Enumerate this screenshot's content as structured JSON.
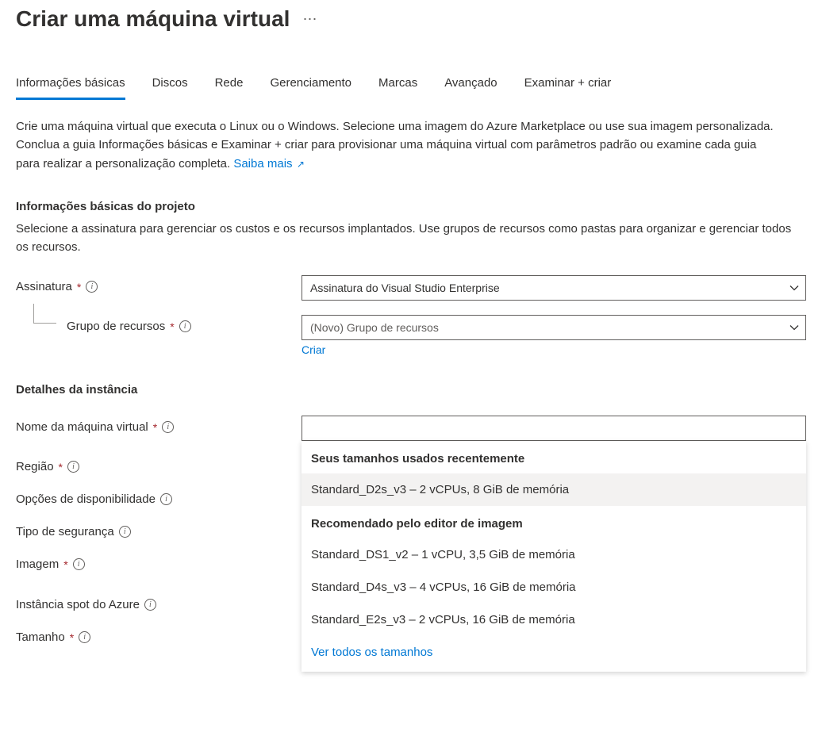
{
  "page_title": "Criar uma máquina virtual",
  "tabs": [
    "Informações básicas",
    "Discos",
    "Rede",
    "Gerenciamento",
    "Marcas",
    "Avançado",
    "Examinar + criar"
  ],
  "active_tab_index": 0,
  "intro_text": "Crie uma máquina virtual que executa o Linux ou o Windows. Selecione uma imagem do Azure Marketplace ou use sua imagem personalizada. Conclua a guia Informações básicas e Examinar + criar para provisionar uma máquina virtual com parâmetros padrão ou examine cada guia para realizar a personalização completa. ",
  "intro_link": "Saiba mais",
  "project_section": {
    "title": "Informações básicas do projeto",
    "desc": "Selecione a assinatura para gerenciar os custos e os recursos implantados. Use grupos de recursos como pastas para organizar e gerenciar todos os recursos.",
    "subscription_label": "Assinatura",
    "subscription_value": "Assinatura do Visual Studio Enterprise",
    "resource_group_label": "Grupo de recursos",
    "resource_group_placeholder": "(Novo) Grupo de recursos",
    "create_new_link": "Criar"
  },
  "instance_section": {
    "title": "Detalhes da instância",
    "vmname_label": "Nome da máquina virtual",
    "vmname_value": "",
    "region_label": "Região",
    "availability_label": "Opções de disponibilidade",
    "security_type_label": "Tipo de segurança",
    "image_label": "Imagem",
    "spot_label": "Instância spot do Azure",
    "size_label": "Tamanho",
    "size_value": "Standard_D2s_v3 – 2 vCPUs, 8 GiB de memória"
  },
  "size_dropdown": {
    "recent_header": "Seus tamanhos usados recentemente",
    "recent_items": [
      "Standard_D2s_v3 – 2 vCPUs, 8 GiB de memória"
    ],
    "recommended_header": "Recomendado pelo editor de imagem",
    "recommended_items": [
      "Standard_DS1_v2 – 1 vCPU, 3,5 GiB de memória",
      "Standard_D4s_v3 – 4 vCPUs, 16 GiB de memória",
      "Standard_E2s_v3 – 2 vCPUs, 16 GiB de memória"
    ],
    "see_all_link": "Ver todos os tamanhos"
  }
}
